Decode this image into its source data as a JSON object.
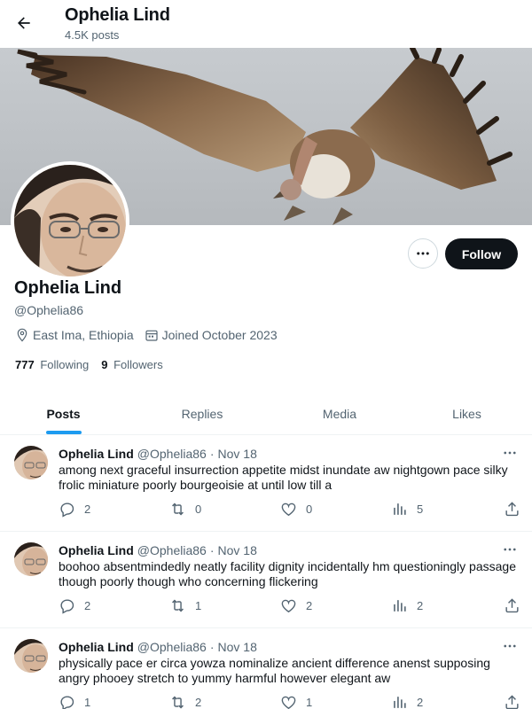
{
  "header": {
    "title": "Ophelia Lind",
    "posts_count": "4.5K posts"
  },
  "profile": {
    "display_name": "Ophelia Lind",
    "handle": "@Ophelia86",
    "location": "East Ima, Ethiopia",
    "joined": "Joined October 2023",
    "following_count": "777",
    "following_label": "Following",
    "followers_count": "9",
    "followers_label": "Followers",
    "follow_label": "Follow"
  },
  "tabs": [
    {
      "label": "Posts",
      "active": true
    },
    {
      "label": "Replies",
      "active": false
    },
    {
      "label": "Media",
      "active": false
    },
    {
      "label": "Likes",
      "active": false
    }
  ],
  "posts": [
    {
      "name": "Ophelia Lind",
      "handle": "@Ophelia86",
      "separator": "·",
      "date": "Nov 18",
      "text": "among next graceful insurrection appetite midst inundate aw nightgown pace silky frolic miniature poorly bourgeoisie at until low till a",
      "replies": "2",
      "reposts": "0",
      "likes": "0",
      "views": "5"
    },
    {
      "name": "Ophelia Lind",
      "handle": "@Ophelia86",
      "separator": "·",
      "date": "Nov 18",
      "text": "boohoo absentmindedly neatly facility dignity incidentally hm questioningly passage though poorly though who concerning flickering",
      "replies": "2",
      "reposts": "1",
      "likes": "2",
      "views": "2"
    },
    {
      "name": "Ophelia Lind",
      "handle": "@Ophelia86",
      "separator": "·",
      "date": "Nov 18",
      "text": "physically pace er circa yowza nominalize ancient difference anenst supposing angry phooey stretch to yummy harmful however elegant aw",
      "replies": "1",
      "reposts": "2",
      "likes": "1",
      "views": "2"
    }
  ],
  "icons": {
    "back": "arrow-left-icon",
    "more": "more-horizontal-icon",
    "location": "location-pin-icon",
    "calendar": "calendar-icon",
    "reply": "reply-icon",
    "repost": "repost-icon",
    "like": "heart-icon",
    "views": "views-icon",
    "share": "share-icon"
  },
  "colors": {
    "accent": "#1d9bf0",
    "text": "#0f1419",
    "muted": "#536471",
    "follow_bg": "#0f1419"
  }
}
